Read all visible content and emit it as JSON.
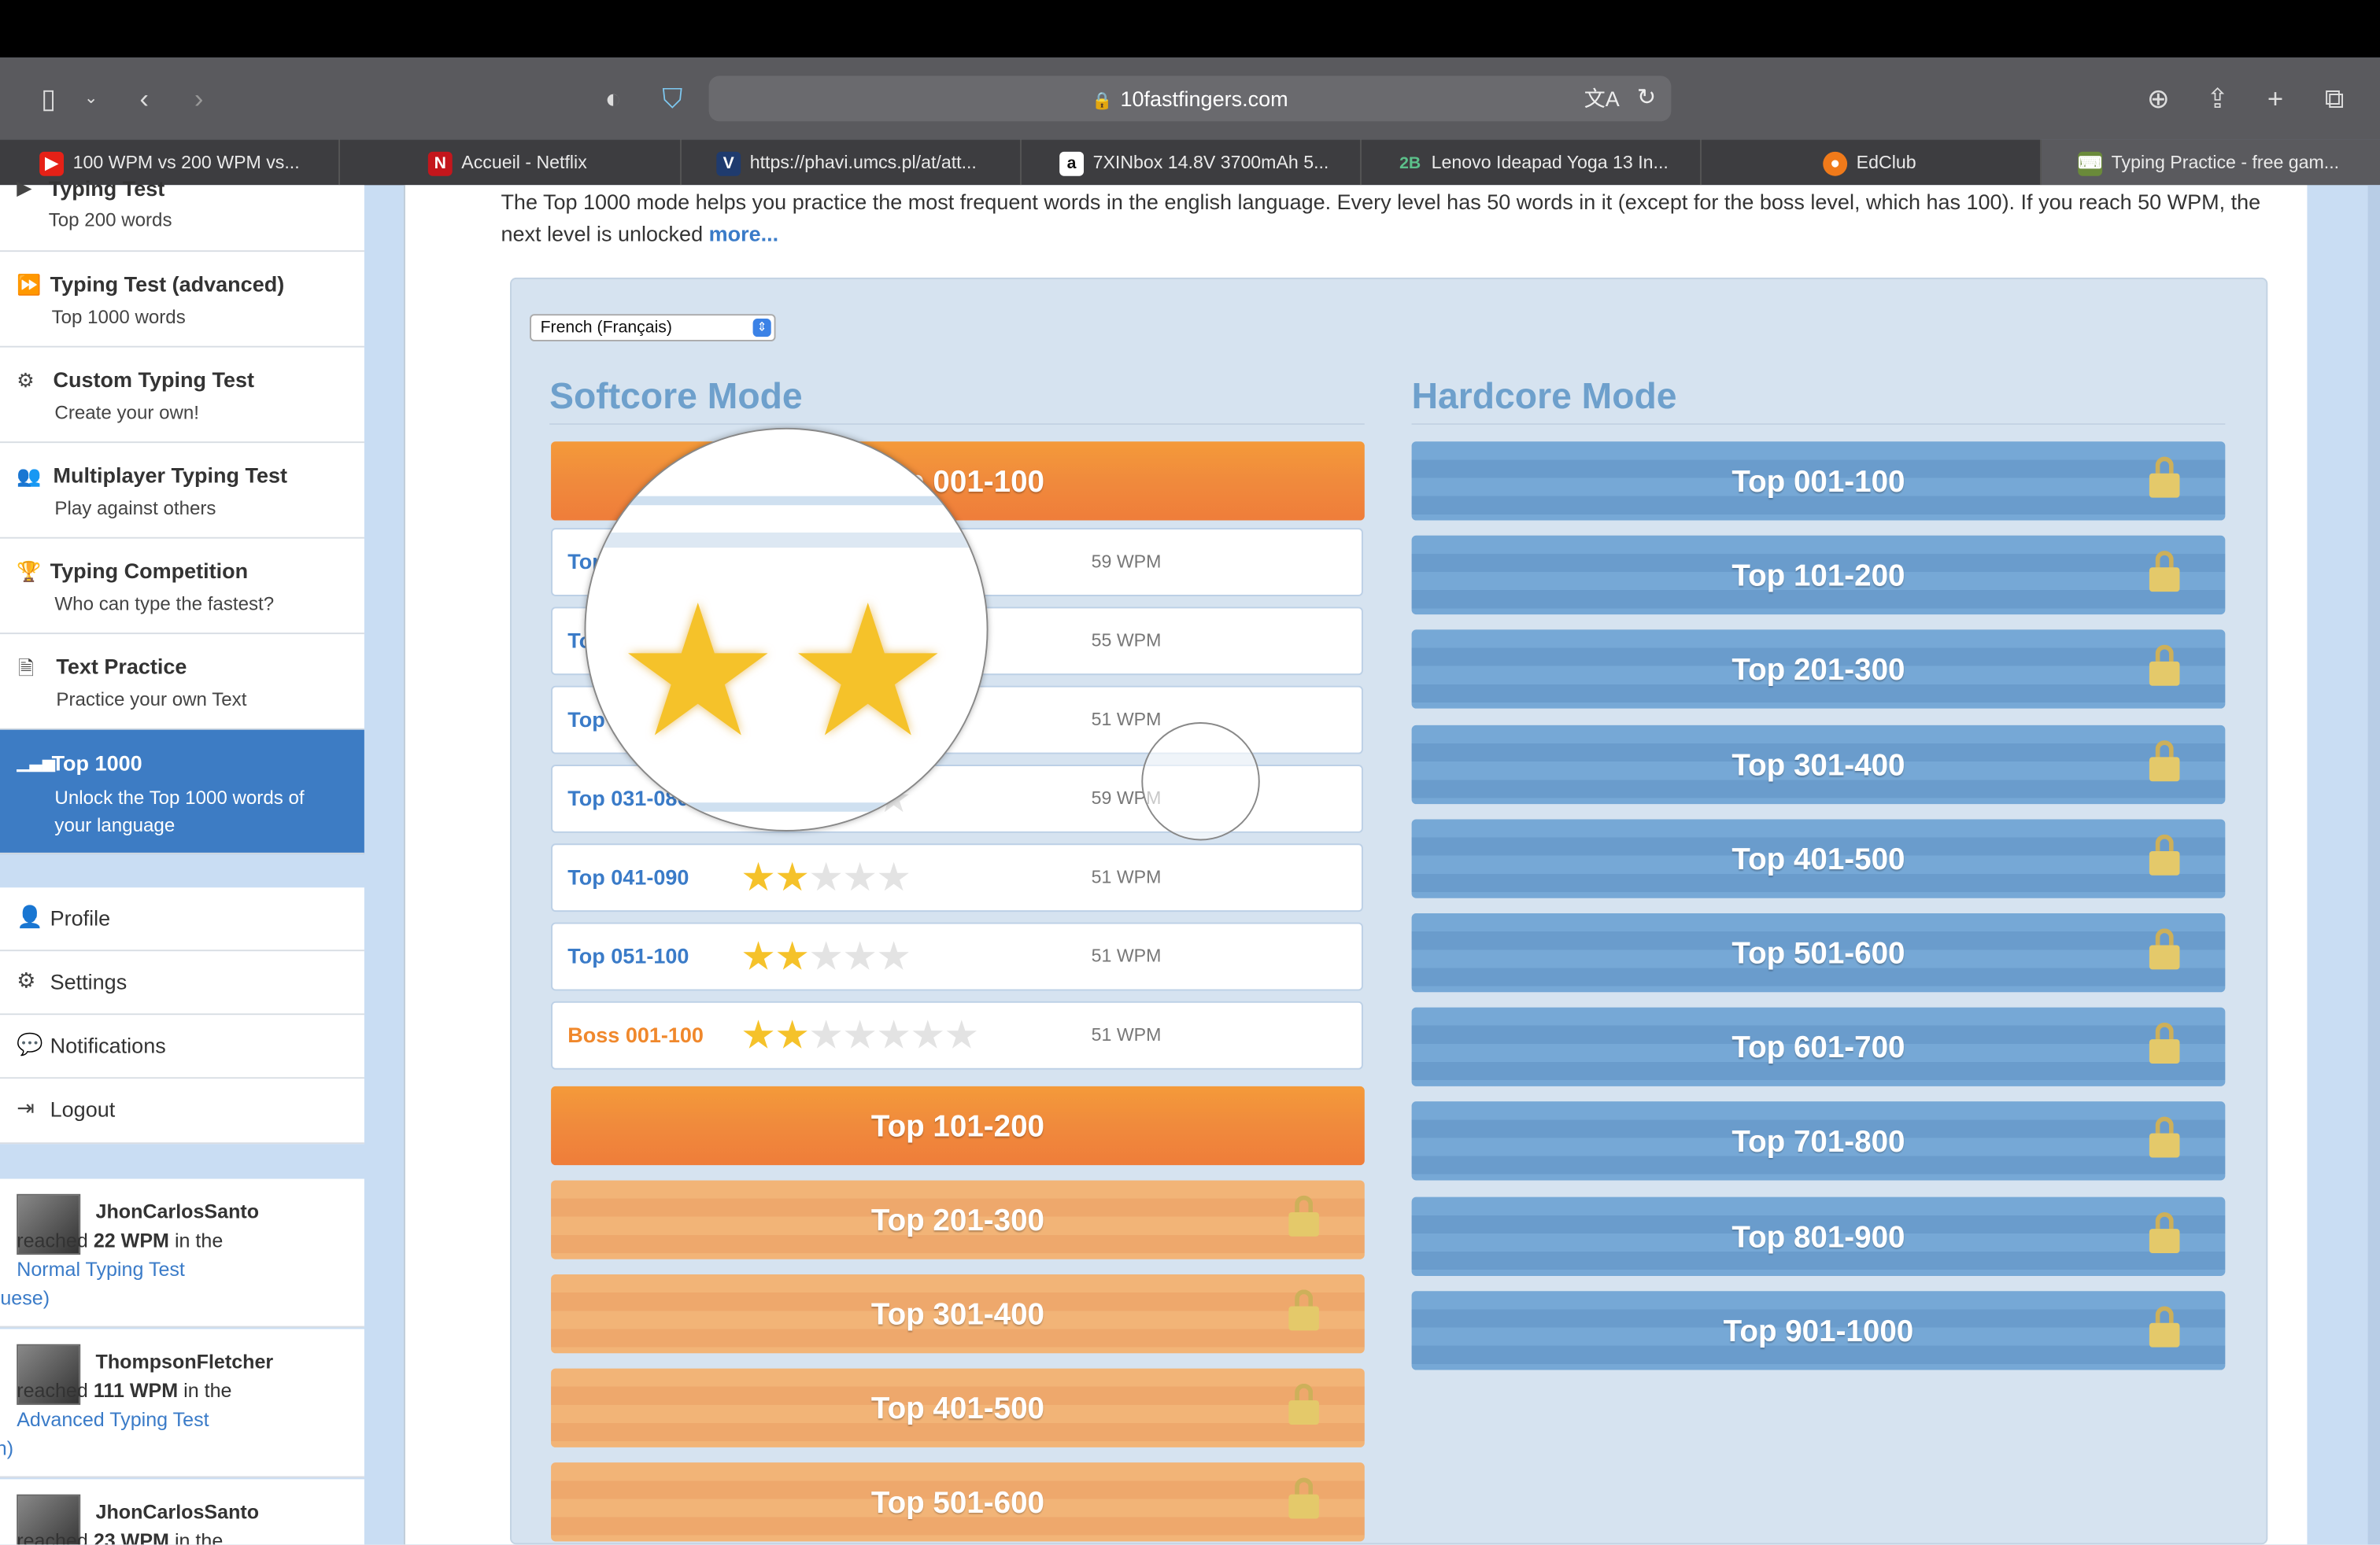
{
  "browser": {
    "url": "10fastfingers.com",
    "tabs": [
      {
        "title": "100 WPM vs 200 WPM vs...",
        "icon": "youtube-icon",
        "color": "#e62117"
      },
      {
        "title": "Accueil - Netflix",
        "icon": "netflix-icon",
        "color": "#c4161c"
      },
      {
        "title": "https://phavi.umcs.pl/at/att...",
        "icon": "v-icon",
        "color": "#1f3b6e"
      },
      {
        "title": "7XINbox 14.8V 3700mAh 5...",
        "icon": "amazon-icon",
        "color": "#222222"
      },
      {
        "title": "Lenovo Ideapad Yoga 13 In...",
        "icon": "2b-icon",
        "color": "#3a9a6a"
      },
      {
        "title": "EdClub",
        "icon": "edclub-icon",
        "color": "#f07a1a"
      },
      {
        "title": "Typing Practice - free gam...",
        "icon": "typing-icon",
        "color": "#6a8a3a"
      }
    ]
  },
  "sidebar": {
    "items": [
      {
        "title": "Typing Test",
        "subtitle": "Top 200 words",
        "icon": "play-icon"
      },
      {
        "title": "Typing Test (advanced)",
        "subtitle": "Top 1000 words",
        "icon": "fast-forward-icon"
      },
      {
        "title": "Custom Typing Test",
        "subtitle": "Create your own!",
        "icon": "gears-icon"
      },
      {
        "title": "Multiplayer Typing Test",
        "subtitle": "Play against others",
        "icon": "users-icon"
      },
      {
        "title": "Typing Competition",
        "subtitle": "Who can type the fastest?",
        "icon": "trophy-icon"
      },
      {
        "title": "Text Practice",
        "subtitle": "Practice your own Text",
        "icon": "document-icon"
      },
      {
        "title": "Top 1000",
        "subtitle": "Unlock the Top 1000 words of your language",
        "icon": "signal-icon"
      }
    ],
    "menu": [
      {
        "label": "Profile",
        "icon": "user-icon"
      },
      {
        "label": "Settings",
        "icon": "gear-icon"
      },
      {
        "label": "Notifications",
        "icon": "comment-icon"
      },
      {
        "label": "Logout",
        "icon": "logout-icon"
      }
    ],
    "feed": [
      {
        "user": "JhonCarlosSanto",
        "pre": "reached",
        "wpm": "22 WPM",
        "mid": "in the",
        "test": "Normal Typing Test",
        "lang": "(portuguese)"
      },
      {
        "user": "ThompsonFletcher",
        "pre": "reached",
        "wpm": "111 WPM",
        "mid": "in the",
        "test": "Advanced Typing Test",
        "lang": "(english)"
      },
      {
        "user": "JhonCarlosSanto",
        "pre": "reached",
        "wpm": "23 WPM",
        "mid": "in the",
        "test": "",
        "lang": ""
      }
    ]
  },
  "main": {
    "intro": "The Top 1000 mode helps you practice the most frequent words in the english language. Every level has 50 words in it (except for the boss level, which has 100). If you reach 50 WPM, the next level is unlocked",
    "more_link": "more...",
    "language": "French (Français)",
    "softcore": {
      "title": "Softcore Mode",
      "active_header": "Top 001-100",
      "levels": [
        {
          "label": "Top 001-050",
          "stars": 2,
          "max": 5,
          "wpm": "59 WPM"
        },
        {
          "label": "Top 011-060",
          "stars": 2,
          "max": 5,
          "wpm": "55 WPM"
        },
        {
          "label": "Top 021-070",
          "stars": 2,
          "max": 5,
          "wpm": "51 WPM"
        },
        {
          "label": "Top 031-080",
          "stars": 2,
          "max": 5,
          "wpm": "59 WPM"
        },
        {
          "label": "Top 041-090",
          "stars": 2,
          "max": 5,
          "wpm": "51 WPM"
        },
        {
          "label": "Top 051-100",
          "stars": 2,
          "max": 5,
          "wpm": "51 WPM"
        },
        {
          "label": "Boss 001-100",
          "stars": 2,
          "max": 7,
          "wpm": "51 WPM",
          "boss": true
        }
      ],
      "open_button": "Top 101-200",
      "locked": [
        "Top 201-300",
        "Top 301-400",
        "Top 401-500",
        "Top 501-600"
      ]
    },
    "hardcore": {
      "title": "Hardcore Mode",
      "locked": [
        "Top 001-100",
        "Top 101-200",
        "Top 201-300",
        "Top 301-400",
        "Top 401-500",
        "Top 501-600",
        "Top 601-700",
        "Top 701-800",
        "Top 801-900",
        "Top 901-1000"
      ]
    }
  }
}
